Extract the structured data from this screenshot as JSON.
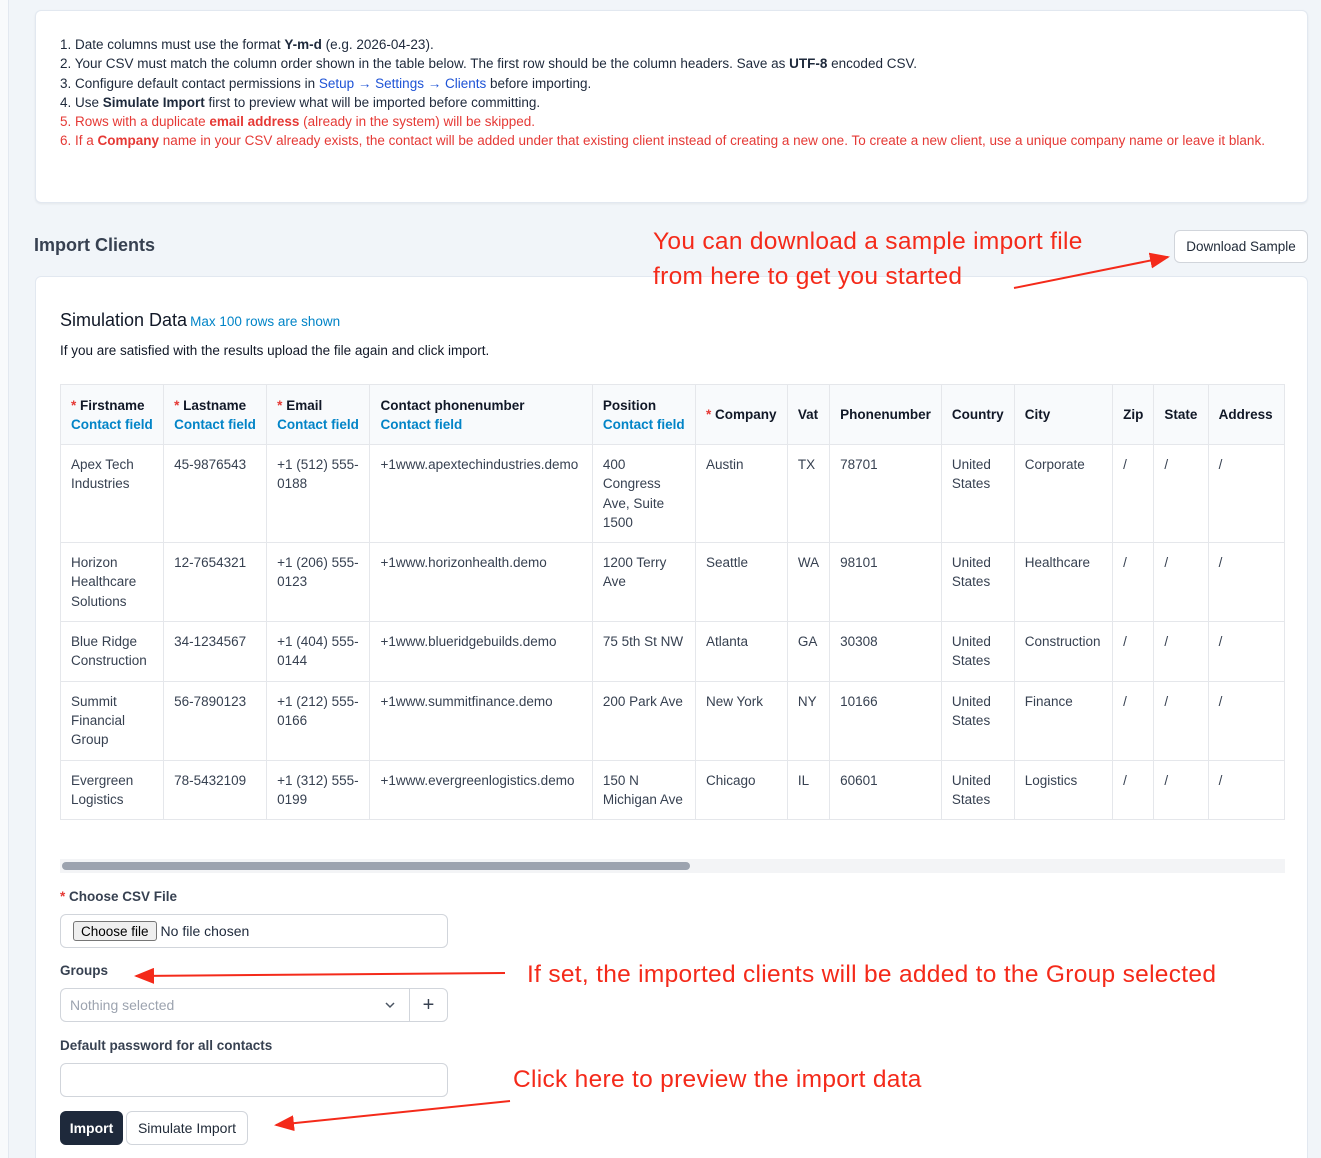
{
  "instructions": {
    "l1_pre": "1. Date columns must use the format ",
    "l1_bold": "Y-m-d",
    "l1_post": " (e.g. 2026-04-23).",
    "l2_pre": "2. Your CSV must match the column order shown in the table below. The first row should be the column headers. Save as ",
    "l2_bold": "UTF-8",
    "l2_post": " encoded CSV.",
    "l3_pre": "3. Configure default contact permissions in ",
    "l3_link": "Setup → Settings → Clients",
    "l3_post": " before importing.",
    "l4_pre": "4. Use ",
    "l4_bold": "Simulate Import",
    "l4_post": " first to preview what will be imported before committing.",
    "l5_pre": "5. Rows with a duplicate ",
    "l5_bold": "email address",
    "l5_post": " (already in the system) will be skipped.",
    "l6_pre": "6. If a ",
    "l6_bold": "Company",
    "l6_post": " name in your CSV already exists, the contact will be added under that existing client instead of creating a new one. To create a new client, use a unique company name or leave it blank."
  },
  "section": {
    "title": "Import Clients",
    "download_sample": "Download Sample"
  },
  "simulation": {
    "title": "Simulation Data",
    "hint": "Max 100 rows are shown",
    "subtitle": "If you are satisfied with the results upload the file again and click import."
  },
  "table": {
    "contact_field_label": "Contact field",
    "required_marker": "*",
    "columns": [
      {
        "label": "Firstname",
        "required": true,
        "contact_field": true
      },
      {
        "label": "Lastname",
        "required": true,
        "contact_field": true
      },
      {
        "label": "Email",
        "required": true,
        "contact_field": true
      },
      {
        "label": "Contact phonenumber",
        "required": false,
        "contact_field": true
      },
      {
        "label": "Position",
        "required": false,
        "contact_field": true
      },
      {
        "label": "Company",
        "required": true,
        "contact_field": false
      },
      {
        "label": "Vat",
        "required": false,
        "contact_field": false
      },
      {
        "label": "Phonenumber",
        "required": false,
        "contact_field": false
      },
      {
        "label": "Country",
        "required": false,
        "contact_field": false
      },
      {
        "label": "City",
        "required": false,
        "contact_field": false
      },
      {
        "label": "Zip",
        "required": false,
        "contact_field": false
      },
      {
        "label": "State",
        "required": false,
        "contact_field": false
      },
      {
        "label": "Address",
        "required": false,
        "contact_field": false
      }
    ],
    "rows": [
      [
        "Apex Tech Industries",
        "45-9876543",
        "+1 (512) 555-0188",
        "+1www.apextechindustries.demo",
        "400 Congress Ave, Suite 1500",
        "Austin",
        "TX",
        "78701",
        "United States",
        "Corporate",
        "/",
        "/",
        "/"
      ],
      [
        "Horizon Healthcare Solutions",
        "12-7654321",
        "+1 (206) 555-0123",
        "+1www.horizonhealth.demo",
        "1200 Terry Ave",
        "Seattle",
        "WA",
        "98101",
        "United States",
        "Healthcare",
        "/",
        "/",
        "/"
      ],
      [
        "Blue Ridge Construction",
        "34-1234567",
        "+1 (404) 555-0144",
        "+1www.blueridgebuilds.demo",
        "75 5th St NW",
        "Atlanta",
        "GA",
        "30308",
        "United States",
        "Construction",
        "/",
        "/",
        "/"
      ],
      [
        "Summit Financial Group",
        "56-7890123",
        "+1 (212) 555-0166",
        "+1www.summitfinance.demo",
        "200 Park Ave",
        "New York",
        "NY",
        "10166",
        "United States",
        "Finance",
        "/",
        "/",
        "/"
      ],
      [
        "Evergreen Logistics",
        "78-5432109",
        "+1 (312) 555-0199",
        "+1www.evergreenlogistics.demo",
        "150 N Michigan Ave",
        "Chicago",
        "IL",
        "60601",
        "United States",
        "Logistics",
        "/",
        "/",
        "/"
      ]
    ]
  },
  "form": {
    "csv_label": "Choose CSV File",
    "required_marker": "*",
    "choose_file": "Choose file",
    "no_file": "No file chosen",
    "groups_label": "Groups",
    "groups_placeholder": "Nothing selected",
    "add_group": "+",
    "password_label": "Default password for all contacts",
    "password_value": "",
    "import_button": "Import",
    "simulate_button": "Simulate Import"
  },
  "annotations": {
    "download_note_line1": "You can download a sample import file",
    "download_note_line2": "from here to get you started",
    "groups_note": "If set, the imported clients will be added to the Group selected",
    "simulate_note": "Click here to preview the import data",
    "color": "#f42a1a"
  }
}
